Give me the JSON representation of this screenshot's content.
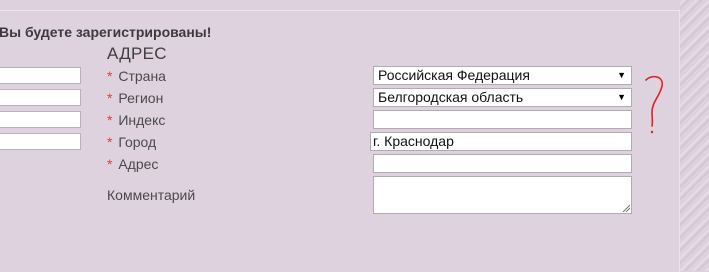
{
  "page": {
    "heading": "Вы будете зарегистрированы!"
  },
  "address": {
    "title": "АДРЕС",
    "required_mark": "*",
    "country": {
      "label": "Страна",
      "value": "Российская Федерация"
    },
    "region": {
      "label": "Регион",
      "value": "Белгородская область"
    },
    "postcode": {
      "label": "Индекс",
      "value": ""
    },
    "city": {
      "label": "Город",
      "value": "г. Краснодар"
    },
    "street": {
      "label": "Адрес",
      "value": ""
    },
    "comment": {
      "label": "Комментарий",
      "value": ""
    }
  },
  "icons": {
    "select_arrow": "▼",
    "annotation": "red-question-mark-icon",
    "resize": "resize-grip-icon"
  },
  "colors": {
    "background": "#dfd2df",
    "required": "#d84040",
    "annotation": "#e02020"
  }
}
